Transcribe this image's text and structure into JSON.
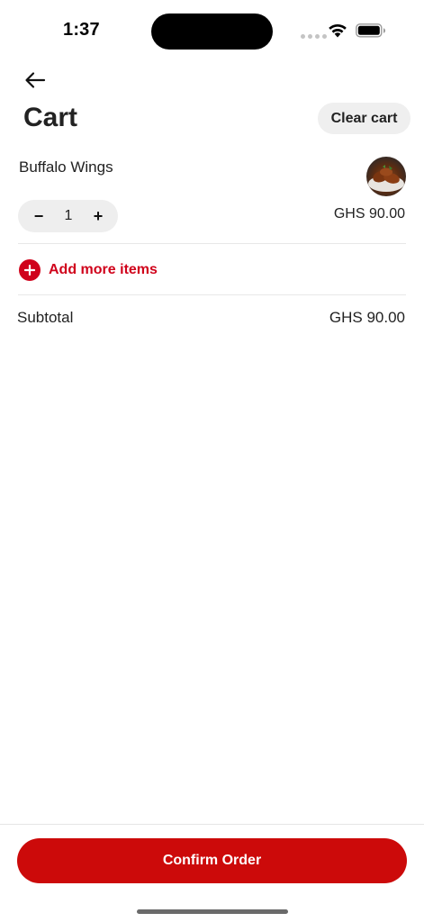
{
  "status_bar": {
    "time": "1:37"
  },
  "header": {
    "back_icon": "arrow-left-icon",
    "title": "Cart",
    "clear_cart_label": "Clear cart"
  },
  "cart": {
    "items": [
      {
        "name": "Buffalo Wings",
        "quantity": "1",
        "price": "GHS 90.00",
        "decrement_symbol": "−",
        "increment_symbol": "+"
      }
    ]
  },
  "add_more": {
    "label": "Add more items",
    "icon": "plus-circle-icon"
  },
  "summary": {
    "subtotal_label": "Subtotal",
    "subtotal_value": "GHS 90.00"
  },
  "footer": {
    "confirm_label": "Confirm Order"
  },
  "colors": {
    "accent": "#cc0a0a",
    "link": "#d0021b",
    "chip_bg": "#efefef"
  }
}
